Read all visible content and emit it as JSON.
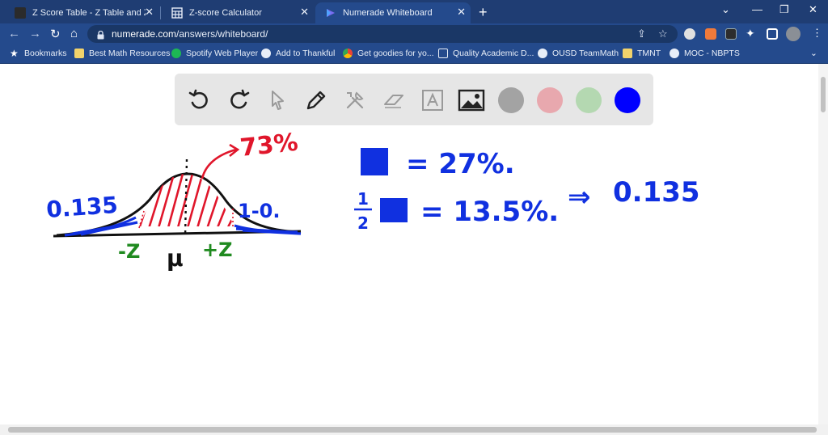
{
  "tabs": [
    {
      "title": "Z Score Table - Z Table and Z sco",
      "icon": "z-table-favicon",
      "active": false
    },
    {
      "title": "Z-score Calculator",
      "icon": "calculator-icon",
      "active": false
    },
    {
      "title": "Numerade Whiteboard",
      "icon": "numerade-icon",
      "active": true
    }
  ],
  "address_bar": {
    "url_host": "numerade.com",
    "url_path": "/answers/whiteboard/"
  },
  "bookmarks": [
    {
      "label": "Bookmarks",
      "icon": "star-icon",
      "color": "#f5c242"
    },
    {
      "label": "Best Math Resources",
      "icon": "folder-icon",
      "color": "#f2d36b"
    },
    {
      "label": "Spotify Web Player",
      "icon": "spotify-icon",
      "color": "#1db954"
    },
    {
      "label": "Add to Thankful",
      "icon": "thankful-icon",
      "color": "#e8eef8"
    },
    {
      "label": "Get goodies for yo...",
      "icon": "chrome-icon",
      "color": "#e94235"
    },
    {
      "label": "Quality Academic D...",
      "icon": "doc-icon",
      "color": "#e8eef8"
    },
    {
      "label": "OUSD TeamMath",
      "icon": "globe-icon",
      "color": "#e8eef8"
    },
    {
      "label": "TMNT",
      "icon": "folder-icon",
      "color": "#f2d36b"
    },
    {
      "label": "MOC - NBPTS",
      "icon": "wordpress-icon",
      "color": "#e8eef8"
    }
  ],
  "whiteboard": {
    "tools": [
      "undo-icon",
      "redo-icon",
      "pointer-icon",
      "pen-icon",
      "tools-icon",
      "eraser-icon",
      "text-icon",
      "image-icon"
    ],
    "colors": [
      "#a3a3a3",
      "#e8a8ae",
      "#b4d8b1",
      "#0000ff"
    ],
    "handwriting": {
      "pct_73": "73%",
      "left_tail": "0.135",
      "right_tail": "1-0.",
      "neg_z": "-Z",
      "mu": "μ",
      "pos_z": "+Z",
      "eq1": "= 27%.",
      "half_num": "1",
      "half_den": "2",
      "eq2": "= 13.5%.",
      "arrow": "⇒",
      "result": "0.135"
    }
  }
}
